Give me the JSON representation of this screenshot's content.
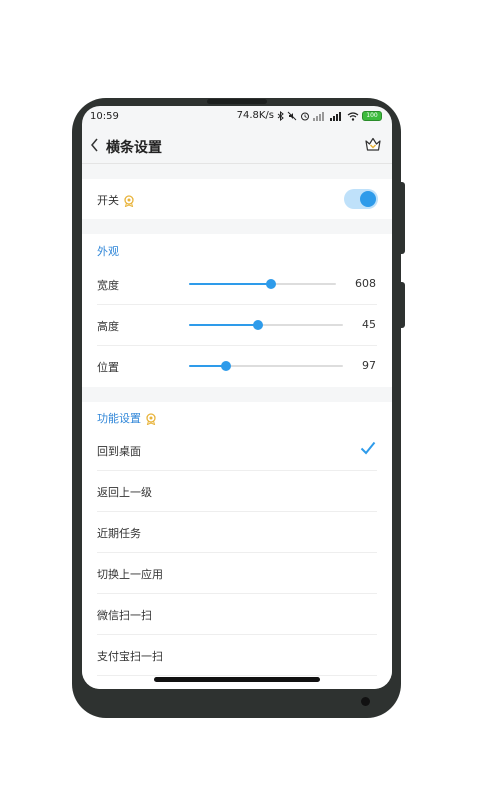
{
  "status_bar": {
    "time": "10:59",
    "net_speed": "74.8K/s",
    "battery": "100"
  },
  "header": {
    "title": "横条设置"
  },
  "switch_section": {
    "label": "开关",
    "enabled": true
  },
  "appearance": {
    "title": "外观",
    "sliders": [
      {
        "label": "宽度",
        "value": "608",
        "fraction": 0.56
      },
      {
        "label": "高度",
        "value": "45",
        "fraction": 0.45
      },
      {
        "label": "位置",
        "value": "97",
        "fraction": 0.24
      }
    ]
  },
  "functions": {
    "title": "功能设置",
    "items": [
      {
        "label": "回到桌面",
        "selected": true
      },
      {
        "label": "返回上一级",
        "selected": false
      },
      {
        "label": "近期任务",
        "selected": false
      },
      {
        "label": "切换上一应用",
        "selected": false
      },
      {
        "label": "微信扫一扫",
        "selected": false
      },
      {
        "label": "支付宝扫一扫",
        "selected": false
      }
    ]
  },
  "colors": {
    "accent": "#2e9bea",
    "section_title": "#2f86d8",
    "badge": "#e8b33a"
  }
}
